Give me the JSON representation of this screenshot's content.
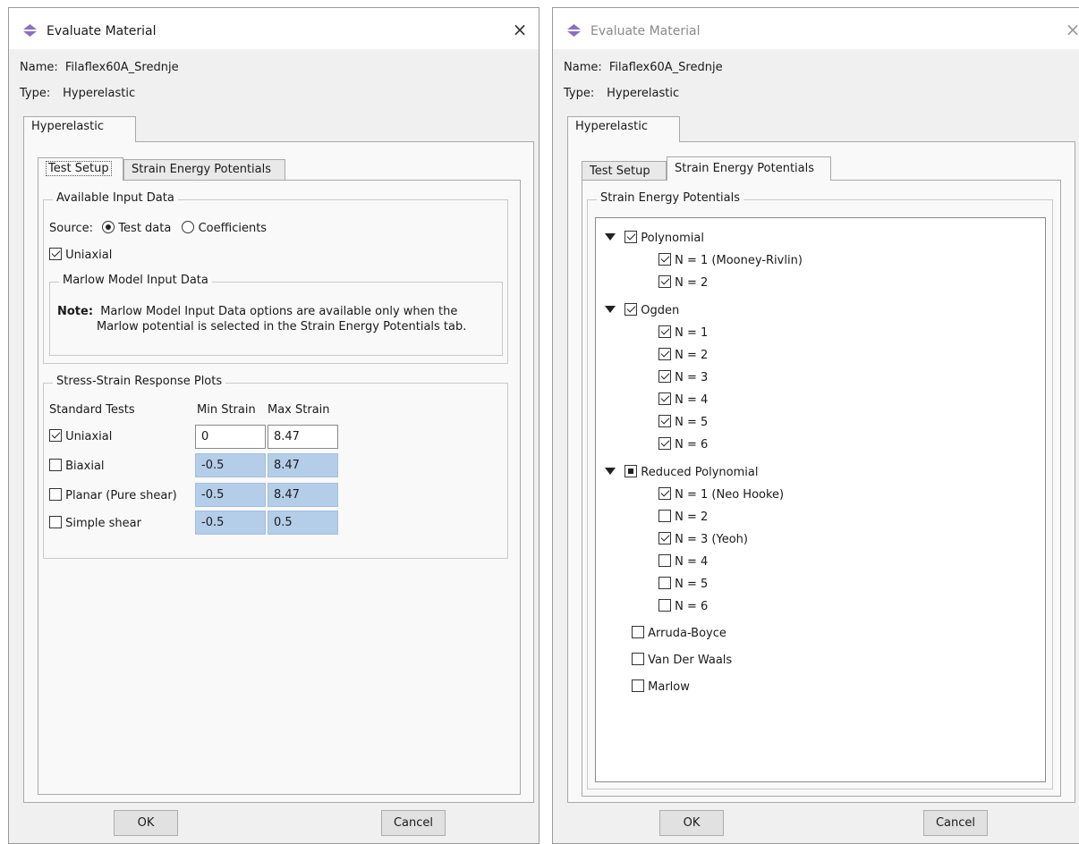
{
  "left": {
    "title": "Evaluate Material",
    "name_label": "Name:",
    "name_value": "Filaflex60A_Srednje",
    "type_label": "Type:",
    "type_value": "Hyperelastic",
    "outer_tab": "Hyperelastic",
    "tabs": [
      "Test Setup",
      "Strain Energy Potentials"
    ],
    "available_group": "Available Input Data",
    "source_label": "Source:",
    "source_options": [
      "Test data",
      "Coefficients"
    ],
    "uniaxial_check": "Uniaxial",
    "marlow_group": "Marlow Model Input Data",
    "note_label": "Note:",
    "note_line1": "Marlow Model Input Data options are available only when the",
    "note_line2": "Marlow potential is selected in the Strain Energy Potentials tab.",
    "plots_group": "Stress-Strain Response Plots",
    "col_tests": "Standard Tests",
    "col_min": "Min Strain",
    "col_max": "Max Strain",
    "rows": [
      {
        "label": "Uniaxial",
        "min": "0",
        "max": "8.47"
      },
      {
        "label": "Biaxial",
        "min": "-0.5",
        "max": "8.47"
      },
      {
        "label": "Planar (Pure shear)",
        "min": "-0.5",
        "max": "8.47"
      },
      {
        "label": "Simple shear",
        "min": "-0.5",
        "max": "0.5"
      }
    ],
    "ok": "OK",
    "cancel": "Cancel"
  },
  "right": {
    "title": "Evaluate Material",
    "name_label": "Name:",
    "name_value": "Filaflex60A_Srednje",
    "type_label": "Type:",
    "type_value": "Hyperelastic",
    "outer_tab": "Hyperelastic",
    "tabs": [
      "Test Setup",
      "Strain Energy Potentials"
    ],
    "sep_group": "Strain Energy Potentials",
    "polynomial": {
      "label": "Polynomial",
      "children": [
        "N = 1 (Mooney-Rivlin)",
        "N = 2"
      ]
    },
    "ogden": {
      "label": "Ogden",
      "children": [
        "N = 1",
        "N = 2",
        "N = 3",
        "N = 4",
        "N = 5",
        "N = 6"
      ]
    },
    "reduced": {
      "label": "Reduced Polynomial",
      "children": [
        "N = 1 (Neo Hooke)",
        "N = 2",
        "N = 3 (Yeoh)",
        "N = 4",
        "N = 5",
        "N = 6"
      ]
    },
    "others": [
      "Arruda-Boyce",
      "Van Der Waals",
      "Marlow"
    ],
    "ok": "OK",
    "cancel": "Cancel"
  }
}
